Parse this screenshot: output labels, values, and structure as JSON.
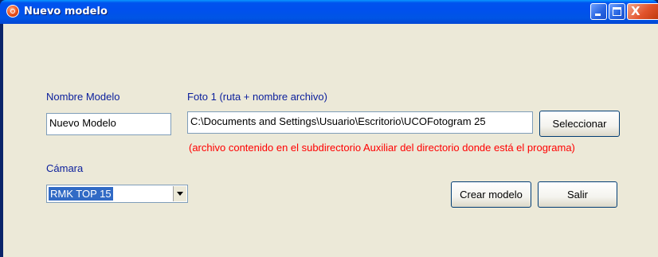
{
  "window": {
    "title": "Nuevo modelo",
    "close_glyph": "X"
  },
  "form": {
    "model_name_label": "Nombre Modelo",
    "model_name_value": "Nuevo Modelo",
    "photo_label": "Foto 1 (ruta + nombre archivo)",
    "photo_path_value": "C:\\Documents and Settings\\Usuario\\Escritorio\\UCOFotogram 25",
    "select_button": "Seleccionar",
    "note": "(archivo contenido en el subdirectorio Auxiliar del directorio  donde está el programa)",
    "camera_label": "Cámara",
    "camera_value": "RMK TOP 15",
    "create_button": "Crear modelo",
    "exit_button": "Salir"
  },
  "icons": {
    "app": "app-icon",
    "minimize": "minimize-icon",
    "maximize": "maximize-icon",
    "close": "close-icon",
    "dropdown": "chevron-down-icon"
  },
  "colors": {
    "titlebar": "#0055e5",
    "client_bg": "#ece9d8",
    "label": "#0a1e9c",
    "note": "#ff0000",
    "selection": "#316ac5"
  }
}
